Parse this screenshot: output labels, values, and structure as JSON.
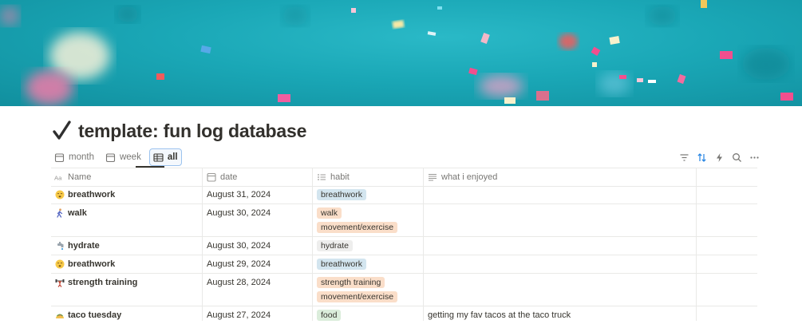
{
  "page": {
    "title": "template: fun log database",
    "title_icon": "check-mark-icon"
  },
  "views": [
    {
      "label": "month",
      "icon": "calendar-icon"
    },
    {
      "label": "week",
      "icon": "calendar-icon"
    },
    {
      "label": "all",
      "icon": "table-icon",
      "active": true
    }
  ],
  "toolbar": [
    "filter-icon",
    "sort-icon",
    "automation-bolt-icon",
    "search-icon",
    "more-icon"
  ],
  "columns": [
    {
      "label": "Name",
      "icon": "text-aa-icon"
    },
    {
      "label": "date",
      "icon": "calendar-icon"
    },
    {
      "label": "habit",
      "icon": "multi-select-list-icon"
    },
    {
      "label": "what i enjoyed",
      "icon": "text-lines-icon"
    }
  ],
  "rows": [
    {
      "emoji": "relieved-face",
      "name": "breathwork",
      "date": "August 31, 2024",
      "habits": [
        {
          "label": "breathwork",
          "color": "#d3e5ef"
        }
      ],
      "enjoyed": ""
    },
    {
      "emoji": "person-walking",
      "name": "walk",
      "date": "August 30, 2024",
      "habits": [
        {
          "label": "walk",
          "color": "#fadec9"
        },
        {
          "label": "movement/exercise",
          "color": "#fadec9"
        }
      ],
      "enjoyed": ""
    },
    {
      "emoji": "water-tap",
      "name": "hydrate",
      "date": "August 30, 2024",
      "habits": [
        {
          "label": "hydrate",
          "color": "#eeeeed"
        }
      ],
      "enjoyed": ""
    },
    {
      "emoji": "relieved-face",
      "name": "breathwork",
      "date": "August 29, 2024",
      "habits": [
        {
          "label": "breathwork",
          "color": "#d3e5ef"
        }
      ],
      "enjoyed": ""
    },
    {
      "emoji": "weight-lifter",
      "name": "strength training",
      "date": "August 28, 2024",
      "habits": [
        {
          "label": "strength training",
          "color": "#fadec9"
        },
        {
          "label": "movement/exercise",
          "color": "#fadec9"
        }
      ],
      "enjoyed": ""
    },
    {
      "emoji": "taco",
      "name": "taco tuesday",
      "date": "August 27, 2024",
      "habits": [
        {
          "label": "food",
          "color": "#dbeddb"
        }
      ],
      "enjoyed": "getting my fav tacos at the taco truck"
    }
  ],
  "colors": {
    "cover_teal": "#1aa7b6",
    "tag_blue": "#d3e5ef",
    "tag_orange": "#fadec9",
    "tag_gray": "#eeeeed",
    "tag_green": "#dbeddb"
  }
}
